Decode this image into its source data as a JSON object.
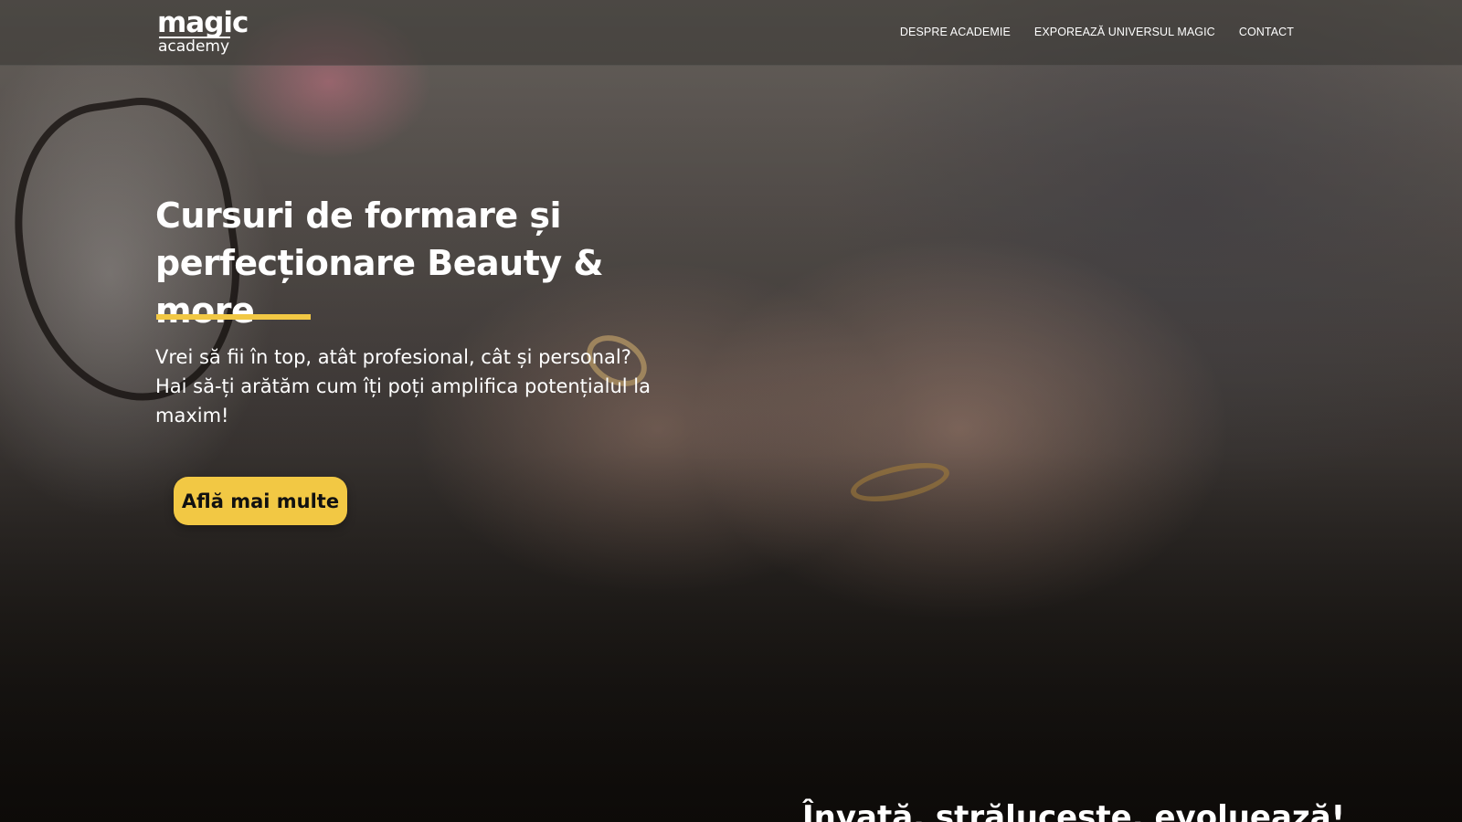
{
  "logo": {
    "top": "magic",
    "bottom": "academy"
  },
  "nav": {
    "items": [
      {
        "label": "DESPRE ACADEMIE"
      },
      {
        "label": "EXPOREAZĂ UNIVERSUL MAGIC"
      },
      {
        "label": "CONTACT"
      }
    ]
  },
  "hero": {
    "title": "Cursuri de formare și perfecționare Beauty & more",
    "description": "Vrei să fii în top, atât profesional, cât și personal? Hai să-ți arătăm cum îți poți amplifica potențialul la maxim!",
    "cta_label": "Află mai multe"
  },
  "next_section": {
    "heading": "Învață, strălucește, evoluează!"
  },
  "colors": {
    "accent": "#f2c844",
    "nav_bar": "#373432",
    "text": "#ffffff"
  }
}
